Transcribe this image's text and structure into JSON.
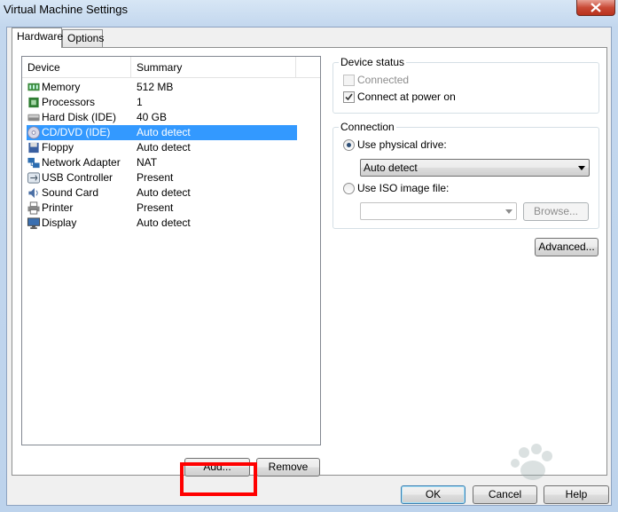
{
  "window": {
    "title": "Virtual Machine Settings"
  },
  "tabs": [
    {
      "label": "Hardware"
    },
    {
      "label": "Options"
    }
  ],
  "device_list": {
    "columns": {
      "device": "Device",
      "summary": "Summary"
    },
    "rows": [
      {
        "device": "Memory",
        "summary": "512 MB",
        "icon": "memory-icon"
      },
      {
        "device": "Processors",
        "summary": "1",
        "icon": "processor-icon"
      },
      {
        "device": "Hard Disk (IDE)",
        "summary": "40 GB",
        "icon": "hard-disk-icon"
      },
      {
        "device": "CD/DVD (IDE)",
        "summary": "Auto detect",
        "icon": "cd-dvd-icon",
        "selected": true
      },
      {
        "device": "Floppy",
        "summary": "Auto detect",
        "icon": "floppy-icon"
      },
      {
        "device": "Network Adapter",
        "summary": "NAT",
        "icon": "network-icon"
      },
      {
        "device": "USB Controller",
        "summary": "Present",
        "icon": "usb-icon"
      },
      {
        "device": "Sound Card",
        "summary": "Auto detect",
        "icon": "sound-icon"
      },
      {
        "device": "Printer",
        "summary": "Present",
        "icon": "printer-icon"
      },
      {
        "device": "Display",
        "summary": "Auto detect",
        "icon": "display-icon"
      }
    ]
  },
  "list_buttons": {
    "add": "Add...",
    "remove": "Remove"
  },
  "device_status": {
    "title": "Device status",
    "connected": {
      "label": "Connected",
      "checked": false,
      "enabled": false
    },
    "connect_power": {
      "label": "Connect at power on",
      "checked": true,
      "enabled": true
    }
  },
  "connection": {
    "title": "Connection",
    "physical": {
      "label": "Use physical drive:",
      "selected": true
    },
    "physical_value": "Auto detect",
    "iso": {
      "label": "Use ISO image file:",
      "selected": false
    },
    "iso_value": "",
    "browse": "Browse..."
  },
  "advanced": "Advanced...",
  "footer": {
    "ok": "OK",
    "cancel": "Cancel",
    "help": "Help"
  },
  "colors": {
    "selection": "#3399ff",
    "highlight_box": "#ff0000"
  }
}
